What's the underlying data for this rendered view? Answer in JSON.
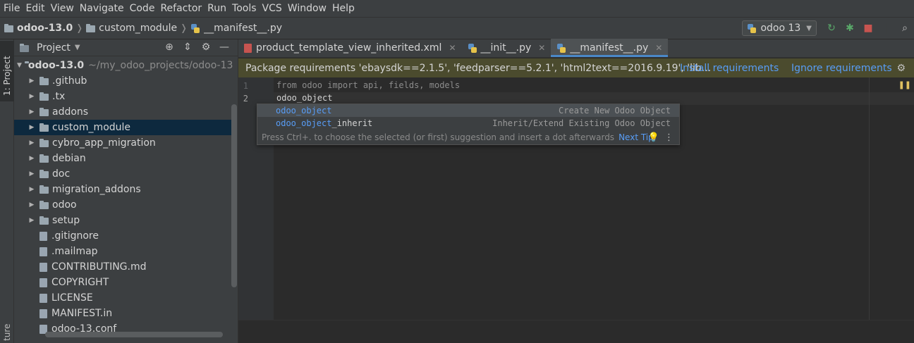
{
  "menu": [
    "File",
    "Edit",
    "View",
    "Navigate",
    "Code",
    "Refactor",
    "Run",
    "Tools",
    "VCS",
    "Window",
    "Help"
  ],
  "breadcrumb": {
    "project": "odoo-13.0",
    "folder": "custom_module",
    "file": "__manifest__.py"
  },
  "toolbar": {
    "run_config": "odoo 13",
    "icons": [
      "run-icon",
      "debug-icon",
      "stop-icon",
      "search-icon"
    ]
  },
  "left_strip": {
    "project_tab": "1: Project",
    "structure_tab": "ture"
  },
  "project_panel": {
    "title": "Project",
    "root": {
      "name": "odoo-13.0",
      "path": "~/my_odoo_projects/odoo-13"
    },
    "items": [
      {
        "name": ".github",
        "type": "folder"
      },
      {
        "name": ".tx",
        "type": "folder"
      },
      {
        "name": "addons",
        "type": "folder"
      },
      {
        "name": "custom_module",
        "type": "folder",
        "selected": true
      },
      {
        "name": "cybro_app_migration",
        "type": "folder"
      },
      {
        "name": "debian",
        "type": "folder"
      },
      {
        "name": "doc",
        "type": "folder"
      },
      {
        "name": "migration_addons",
        "type": "folder"
      },
      {
        "name": "odoo",
        "type": "folder"
      },
      {
        "name": "setup",
        "type": "folder"
      },
      {
        "name": ".gitignore",
        "type": "file"
      },
      {
        "name": ".mailmap",
        "type": "file"
      },
      {
        "name": "CONTRIBUTING.md",
        "type": "file"
      },
      {
        "name": "COPYRIGHT",
        "type": "file"
      },
      {
        "name": "LICENSE",
        "type": "file"
      },
      {
        "name": "MANIFEST.in",
        "type": "file"
      },
      {
        "name": "odoo-13.conf",
        "type": "file"
      }
    ]
  },
  "tabs": [
    {
      "label": "product_template_view_inherited.xml",
      "kind": "xml"
    },
    {
      "label": "__init__.py",
      "kind": "py"
    },
    {
      "label": "__manifest__.py",
      "kind": "py",
      "active": true
    }
  ],
  "banner": {
    "message": "Package requirements 'ebaysdk==2.1.5', 'feedparser==5.2.1', 'html2text==2016.9.19', 'lib...",
    "install": "Install requirements",
    "ignore": "Ignore requirements"
  },
  "code": {
    "lines": [
      {
        "num": "1",
        "text": "from odoo import api, fields, models"
      },
      {
        "num": "2",
        "text": "odoo_object"
      }
    ]
  },
  "completion": {
    "items": [
      {
        "match": "odoo_object",
        "rest": "",
        "type": "Create New Odoo Object"
      },
      {
        "match": "odoo_object",
        "rest": "_inherit",
        "type": "Inherit/Extend Existing Odoo Object"
      }
    ],
    "hint": "Press Ctrl+. to choose the selected (or first) suggestion and insert a dot afterwards",
    "next_tip": "Next Tip"
  }
}
